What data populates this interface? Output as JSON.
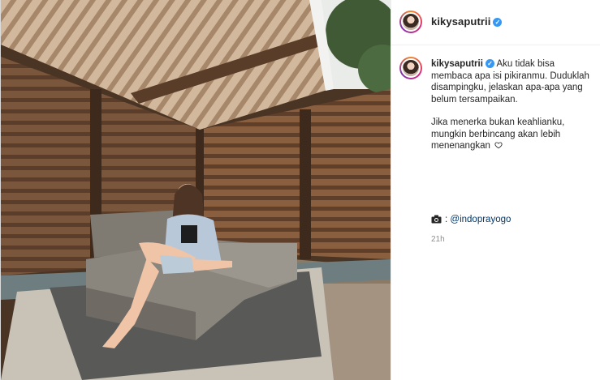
{
  "post": {
    "username": "kikysaputrii",
    "verified": true,
    "caption_line1": "Aku tidak bisa membaca apa isi pikiranmu. Duduklah disampingku, jelaskan apa-apa yang belum tersampaikan.",
    "caption_line2": "Jika menerka bukan keahlianku, mungkin berbincang akan lebih menenangkan",
    "credit_prefix": ":",
    "credit_mention": "@indoprayogo",
    "timestamp": "21h"
  },
  "icons": {
    "verified": "verified-badge-icon",
    "heart": "white-heart-icon",
    "camera": "camera-icon"
  },
  "colors": {
    "verified_blue": "#3897f0",
    "mention_blue": "#00376b",
    "meta_gray": "#8e8e8e"
  }
}
